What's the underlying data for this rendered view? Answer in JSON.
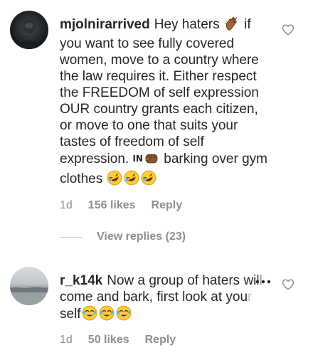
{
  "comments": [
    {
      "username": "mjolnirarrived",
      "text_part1": "Hey haters",
      "text_part2": "if you want to see fully covered women, move to a country where the law requires it. Either respect the FREEDOM of self expression OUR country grants each citizen, or move to one that suits your tastes of freedom of self expression.",
      "badge": "IN",
      "text_part3": "barking over gym clothes",
      "timestamp": "1d",
      "likes": "156 likes",
      "reply": "Reply",
      "view_replies": "View replies (23)"
    },
    {
      "username": "r_k14k",
      "text_part1": "Now a group of haters wi",
      "text_faded_1": "ll",
      "text_line2": "come and bark, first look at you",
      "text_faded_2": "r",
      "text_line3": "self",
      "timestamp": "1d",
      "likes": "50 likes",
      "reply": "Reply"
    }
  ],
  "icons": {
    "like": "heart-outline-icon",
    "more": "more-horizontal-icon"
  },
  "colors": {
    "text": "#262626",
    "secondary": "#8e8e8e",
    "divider": "#c7c7c7"
  }
}
